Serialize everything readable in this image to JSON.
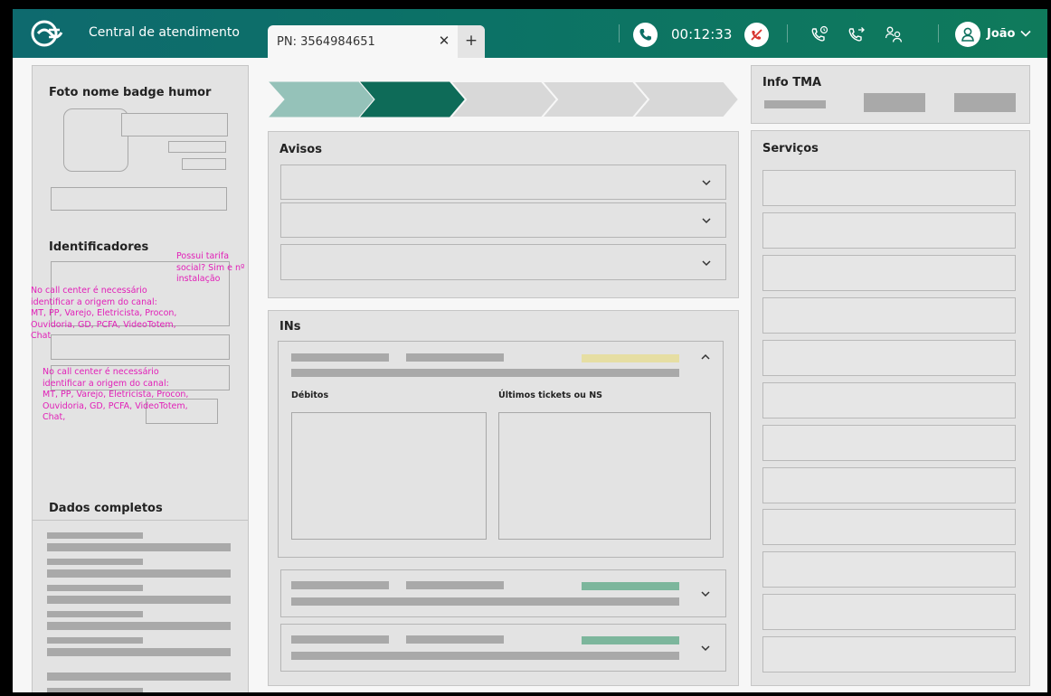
{
  "header": {
    "app_title": "Central de atendimento",
    "tab_label": "PN: 3564984651",
    "tab_close": "✕",
    "tab_add": "+",
    "call_timer": "00:12:33",
    "user_name": "João"
  },
  "left": {
    "profile_title": "Foto nome badge humor",
    "identifiers_title": "Identificadores",
    "note_tarifa": "Possui tarifa\nsocial? Sim e nº\ninstalação",
    "note_origem_1": "No call center é necessário\nidentificar a origem do canal:\nMT, PP, Varejo, Eletricista, Procon,\nOuvidoria, GD, PCFA, VideoTotem,\nChat",
    "note_origem_2": "No call center é necessário\nidentificar a origem do canal:\nMT, PP, Varejo, Eletricista, Procon,\nOuvidoria, GD, PCFA, VideoTotem,\nChat,",
    "full_data_title": "Dados completos"
  },
  "middle": {
    "avisos_title": "Avisos",
    "ins_title": "INs",
    "debitos_label": "Débitos",
    "tickets_label": "Últimos tickets ou NS"
  },
  "right": {
    "tma_title": "Info TMA",
    "services_title": "Serviços"
  },
  "colors": {
    "header_start": "#0e6a6e",
    "header_end": "#0f7a5b",
    "step_done": "#95c2b9",
    "step_active": "#0e6b58",
    "step_todo": "#d8d8d8",
    "status_yellow": "#e6dea3",
    "status_green": "#7cb69c",
    "annotation_pink": "#e21fb8"
  },
  "icons": [
    "logo-icon",
    "close-icon",
    "plus-icon",
    "phone-icon",
    "mic-off-icon",
    "call-history-icon",
    "call-forward-icon",
    "users-icon",
    "user-avatar-icon",
    "chevron-down-icon",
    "chevron-up-icon"
  ]
}
